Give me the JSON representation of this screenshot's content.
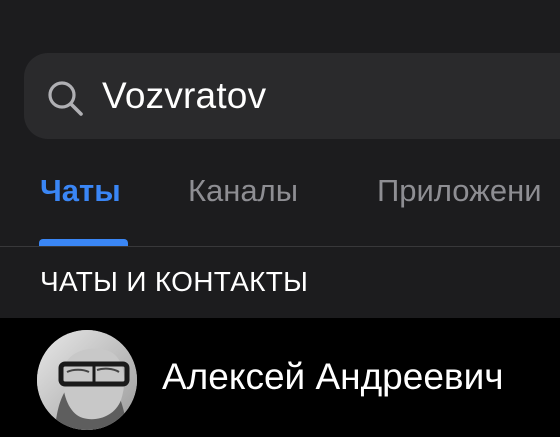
{
  "search": {
    "icon": "search-icon",
    "value": "Vozvratov"
  },
  "tabs": [
    {
      "label": "Чаты",
      "active": true
    },
    {
      "label": "Каналы",
      "active": false
    },
    {
      "label": "Приложени",
      "active": false
    }
  ],
  "section": {
    "title": "ЧАТЫ И КОНТАКТЫ"
  },
  "results": [
    {
      "name": "Алексей Андреевич",
      "avatar": "user-avatar-photo"
    }
  ],
  "colors": {
    "accent": "#3a86f5",
    "background": "#1c1c1e",
    "search_field": "#2a2a2c",
    "inactive_tab": "#8e8e93",
    "row_background": "#000000"
  }
}
